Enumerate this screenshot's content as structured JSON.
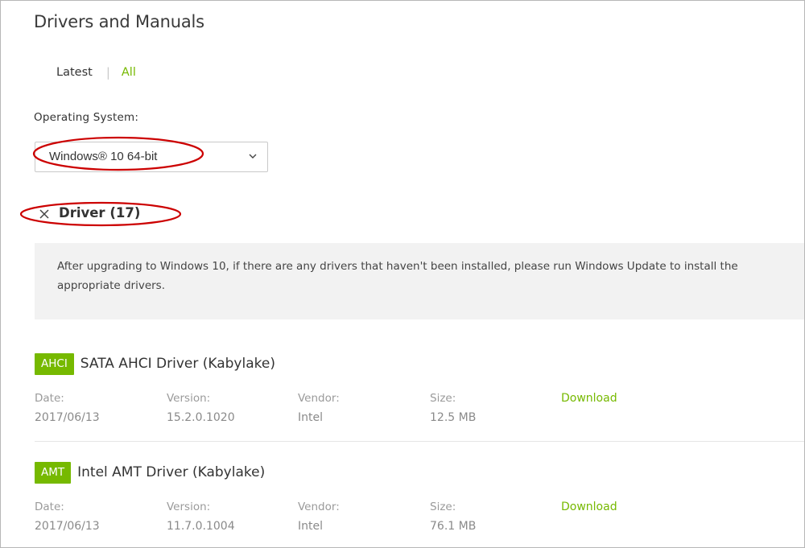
{
  "page": {
    "title": "Drivers and Manuals"
  },
  "tabs": {
    "latest": "Latest",
    "separator": "|",
    "all": "All"
  },
  "os": {
    "label": "Operating System:",
    "selected": "Windows® 10 64-bit"
  },
  "driver_section": {
    "title": "Driver (17)",
    "notice": "After upgrading to Windows 10, if there are any drivers that haven't been installed, please run Windows Update to install the appropriate drivers."
  },
  "column_labels": {
    "date": "Date:",
    "version": "Version:",
    "vendor": "Vendor:",
    "size": "Size:"
  },
  "drivers": [
    {
      "badge": "AHCI",
      "name": "SATA AHCI Driver (Kabylake)",
      "date": "2017/06/13",
      "version": "15.2.0.1020",
      "vendor": "Intel",
      "size": "12.5 MB",
      "action": "Download"
    },
    {
      "badge": "AMT",
      "name": "Intel AMT Driver (Kabylake)",
      "date": "2017/06/13",
      "version": "11.7.0.1004",
      "vendor": "Intel",
      "size": "76.1 MB",
      "action": "Download"
    }
  ],
  "colors": {
    "accent": "#76b900",
    "highlight_ellipse": "#cc0000"
  }
}
